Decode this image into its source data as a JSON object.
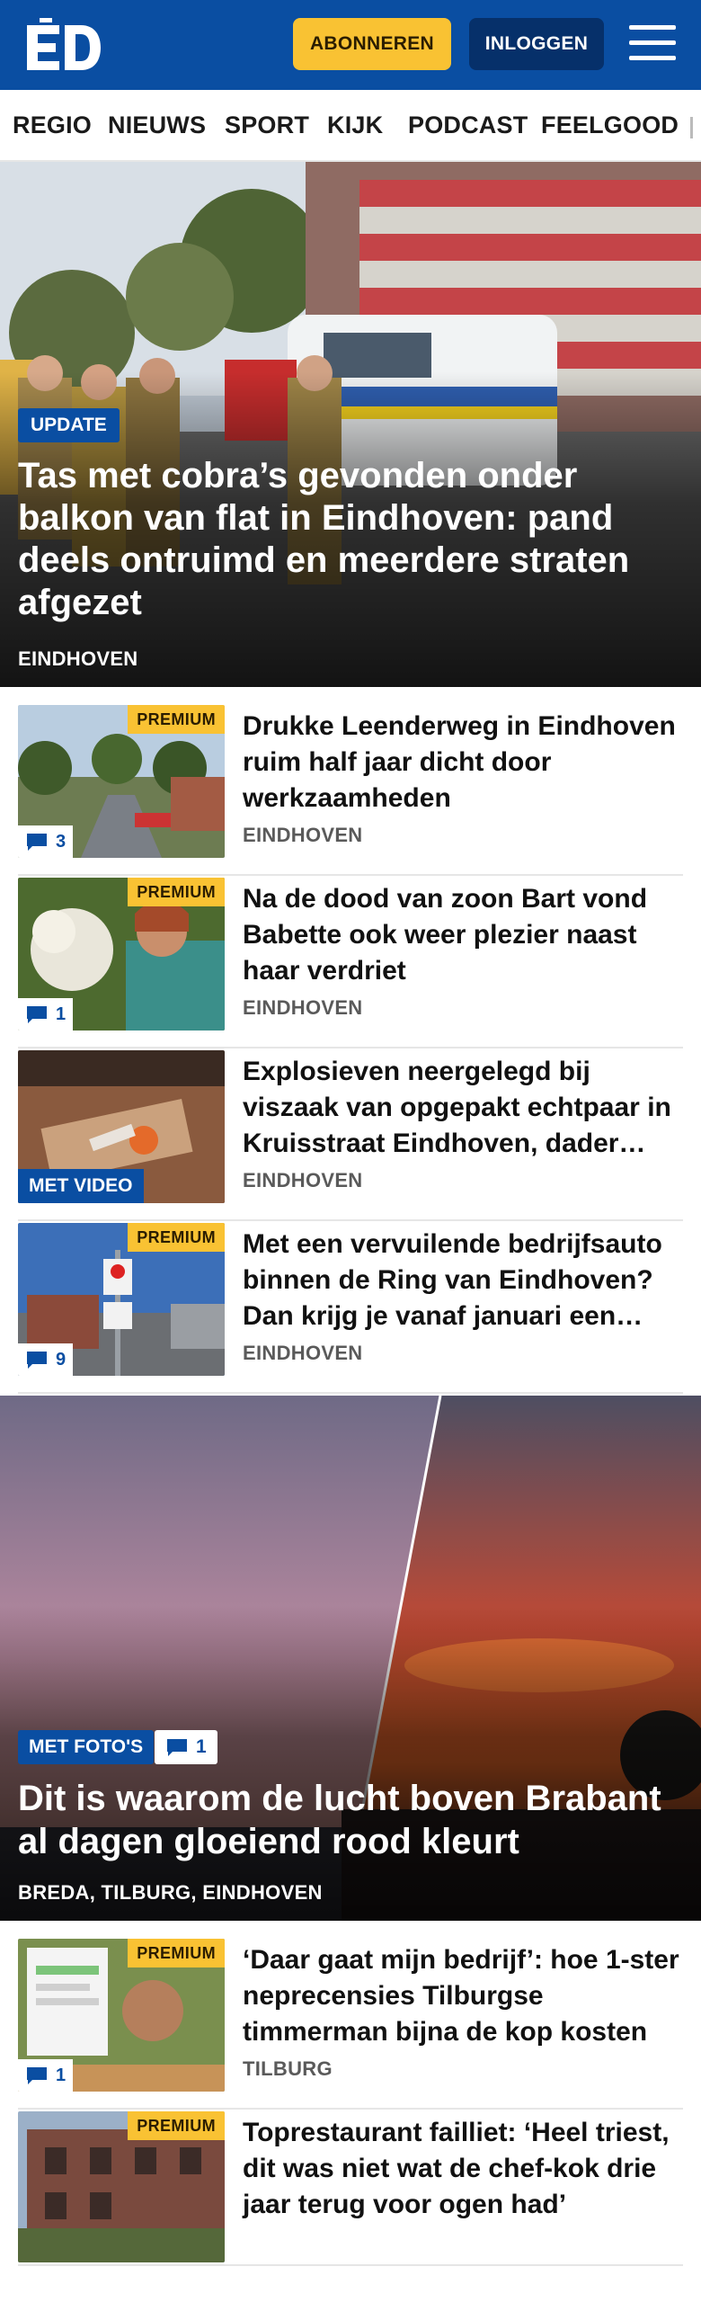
{
  "header": {
    "logo_text": "ED",
    "subscribe_label": "ABONNEREN",
    "login_label": "INLOGGEN",
    "menu_icon": "hamburger-menu-icon",
    "brand_color": "#0a4ea2",
    "accent_color": "#f9c233"
  },
  "nav": {
    "items": [
      "REGIO",
      "NIEUWS",
      "SPORT",
      "KIJK",
      "PODCAST",
      "FEELGOOD"
    ]
  },
  "hero": {
    "label": "UPDATE",
    "title": "Tas met cobra’s gevonden onder balkon van flat in Eindhoven: pand deels ontruimd en meerdere straten afgezet",
    "location": "EINDHOVEN"
  },
  "articles": [
    {
      "badge": "PREMIUM",
      "comments": "3",
      "title": "Drukke Leenderweg in Eindhoven ruim half jaar dicht door werkzaamheden",
      "location": "EINDHOVEN"
    },
    {
      "badge": "PREMIUM",
      "comments": "1",
      "title": "Na de dood van zoon Bart vond Babette ook weer plezier naast haar verdriet",
      "location": "EINDHOVEN"
    },
    {
      "badge": "MET VIDEO",
      "title": "Explosieven neergelegd bij viszaak van opgepakt echtpaar in Kruisstraat Eindhoven, dader…",
      "location": "EINDHOVEN"
    },
    {
      "badge": "PREMIUM",
      "comments": "9",
      "title": "Met een vervuilende bedrijfsauto binnen de Ring van Eindhoven? Dan krijg je vanaf januari een…",
      "location": "EINDHOVEN"
    }
  ],
  "hero2": {
    "label": "MET FOTO'S",
    "comments": "1",
    "title": "Dit is waarom de lucht boven Brabant al dagen gloeiend rood kleurt",
    "location": "BREDA, TILBURG, EINDHOVEN"
  },
  "articles2": [
    {
      "badge": "PREMIUM",
      "comments": "1",
      "title": "‘Daar gaat mijn bedrijf’: hoe 1-ster neprecensies Tilburgse timmerman bijna de kop kosten",
      "location": "TILBURG"
    },
    {
      "badge": "PREMIUM",
      "title": "Toprestaurant failliet: ‘Heel triest, dit was niet wat de chef-kok drie jaar terug voor ogen had’"
    }
  ]
}
